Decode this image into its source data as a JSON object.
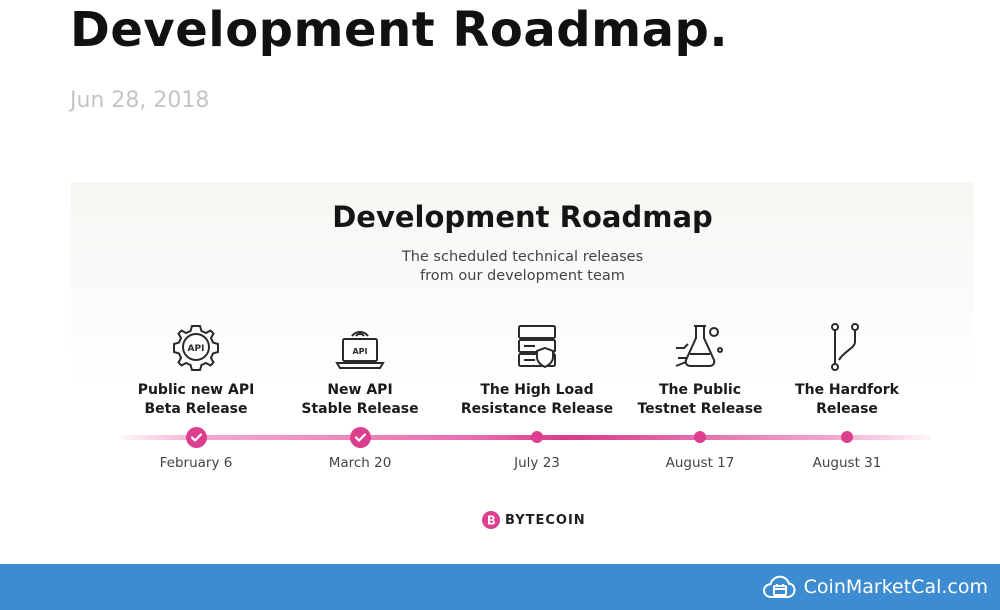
{
  "page": {
    "title": "Development Roadmap.",
    "date": "Jun 28, 2018"
  },
  "roadmap": {
    "title": "Development Roadmap",
    "subtitle_lines": [
      "The scheduled technical releases",
      "from our development team"
    ],
    "accent_color": "#dc3f8e",
    "milestones": [
      {
        "label_lines": [
          "Public new API",
          "Beta Release"
        ],
        "date": "February 6",
        "icon": "api-gear-icon",
        "icon_text": "API",
        "completed": true
      },
      {
        "label_lines": [
          "New API",
          "Stable Release"
        ],
        "date": "March 20",
        "icon": "api-laptop-icon",
        "icon_text": "API",
        "completed": true
      },
      {
        "label_lines": [
          "The High Load",
          "Resistance Release"
        ],
        "date": "July 23",
        "icon": "server-shield-icon",
        "completed": false
      },
      {
        "label_lines": [
          "The Public",
          "Testnet Release"
        ],
        "date": "August 17",
        "icon": "test-flask-icon",
        "completed": false
      },
      {
        "label_lines": [
          "The Hardfork",
          "Release"
        ],
        "date": "August 31",
        "icon": "git-fork-icon",
        "completed": false
      }
    ],
    "brand": "BYTECOIN"
  },
  "footer": {
    "site": "CoinMarketCal.com",
    "color": "#3d8bd1",
    "logo": "cloud-calendar-icon"
  }
}
